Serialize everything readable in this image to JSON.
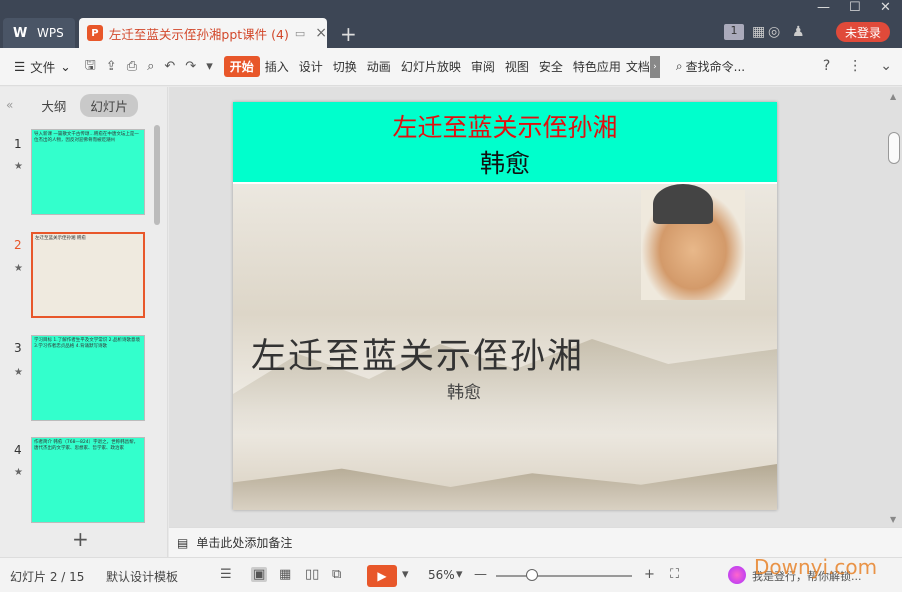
{
  "titlebar": {
    "app_tab": "WPS",
    "doc_tab_title": "左迁至蓝关示侄孙湘ppt课件 (4)",
    "login": "未登录",
    "badge": "1"
  },
  "ribbon": {
    "menu_label": "文件",
    "tabs": [
      "开始",
      "插入",
      "设计",
      "切换",
      "动画",
      "幻灯片放映",
      "审阅",
      "视图",
      "安全",
      "特色应用",
      "文档"
    ],
    "find_cmd": "查找命令..."
  },
  "left_panel": {
    "tab_outline": "大纲",
    "tab_slides": "幻灯片",
    "thumbnails": [
      {
        "num": "1",
        "text": "导入新课 一篇散文千古传颂…韩愈在中唐文坛上是一位杰出的人物，因反对迎佛骨而被贬潮州"
      },
      {
        "num": "2",
        "text": "左迁至蓝关示侄孙湘 韩愈"
      },
      {
        "num": "3",
        "text": "学习目标 1.了解作者生平及文学常识 2.品析诗歌意境 3.学习作者忠贞品格 4.背诵默写诗歌"
      },
      {
        "num": "4",
        "text": "作者简介 韩愈（768—824）字退之，世称韩昌黎，唐代杰出的文学家、思想家、哲学家、政治家"
      }
    ]
  },
  "slide": {
    "title": "左迁至蓝关示侄孙湘",
    "author": "韩愈",
    "big_title": "左迁至蓝关示侄孙湘",
    "big_author": "韩愈"
  },
  "notes": {
    "placeholder": "单击此处添加备注"
  },
  "statusbar": {
    "slide_counter": "幻灯片 2 / 15",
    "template": "默认设计模板",
    "zoom": "56%",
    "login_hint": "我是登行，帮你解锁..."
  },
  "watermark": "Downyi.com"
}
